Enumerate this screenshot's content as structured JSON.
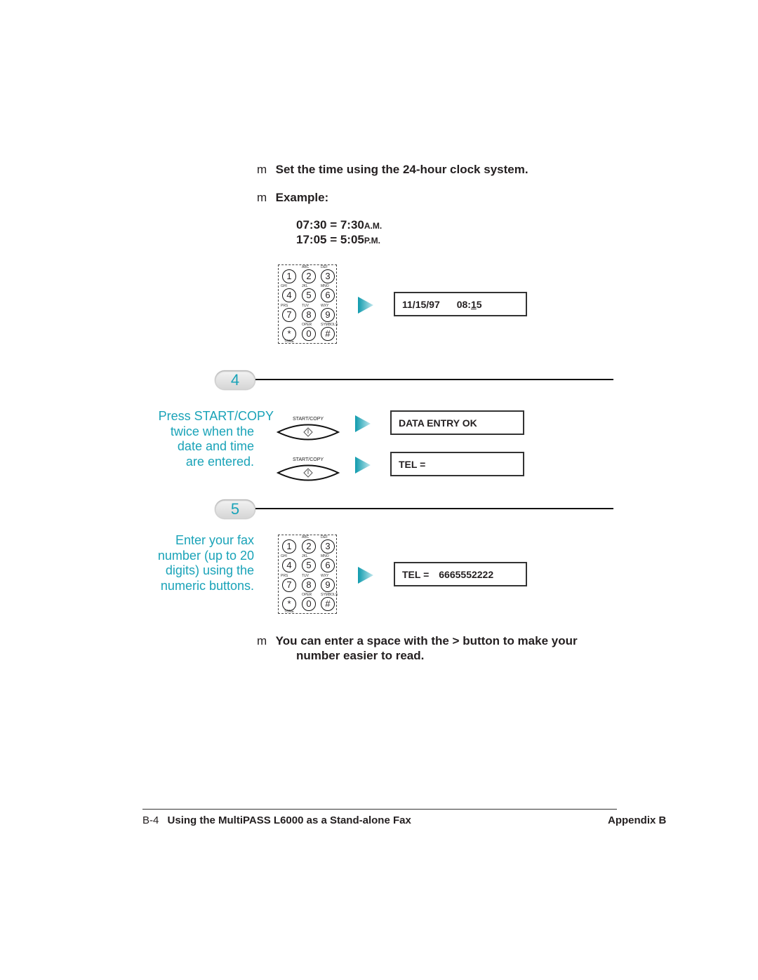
{
  "instructions": {
    "bullet_glyph": "m",
    "set_time": "Set the time using the 24-hour clock system.",
    "example_label": "Example:",
    "example_lines": [
      {
        "time24": "07:30 = 7:30",
        "suffix": "A.M."
      },
      {
        "time24": "17:05 = 5:05",
        "suffix": "P.M."
      }
    ],
    "space_tip_line1": "You can enter a space with the > button to make your",
    "space_tip_line2": "number easier to read."
  },
  "keypad": {
    "keys": [
      "1",
      "2",
      "3",
      "4",
      "5",
      "6",
      "7",
      "8",
      "9",
      "*",
      "0",
      "#"
    ],
    "letters": [
      "",
      "ABC",
      "DEF",
      "GHI",
      "JKL",
      "MNO",
      "PRS",
      "TUV",
      "WXY",
      "",
      "OPER",
      "SYMBOLS"
    ],
    "tone_label": "TONE"
  },
  "displays": {
    "date_time": {
      "date": "11/15/97",
      "time_prefix": "08:",
      "time_cursor": "1",
      "time_suffix": "5"
    },
    "data_entry_ok": "DATA ENTRY OK",
    "tel_empty": "TEL =",
    "tel_filled_label": "TEL =",
    "tel_filled_number": "6665552222"
  },
  "steps": [
    {
      "number": "4",
      "text": [
        "Press START/COPY",
        "twice when the",
        "date and time",
        "are entered."
      ]
    },
    {
      "number": "5",
      "text": [
        "Enter your fax",
        "number (up to 20",
        "digits) using the",
        "numeric buttons."
      ]
    }
  ],
  "start_button": {
    "label": "START/COPY"
  },
  "footer": {
    "page": "B-4",
    "title": "Using the MultiPASS L6000 as a Stand-alone Fax",
    "section": "Appendix B"
  }
}
